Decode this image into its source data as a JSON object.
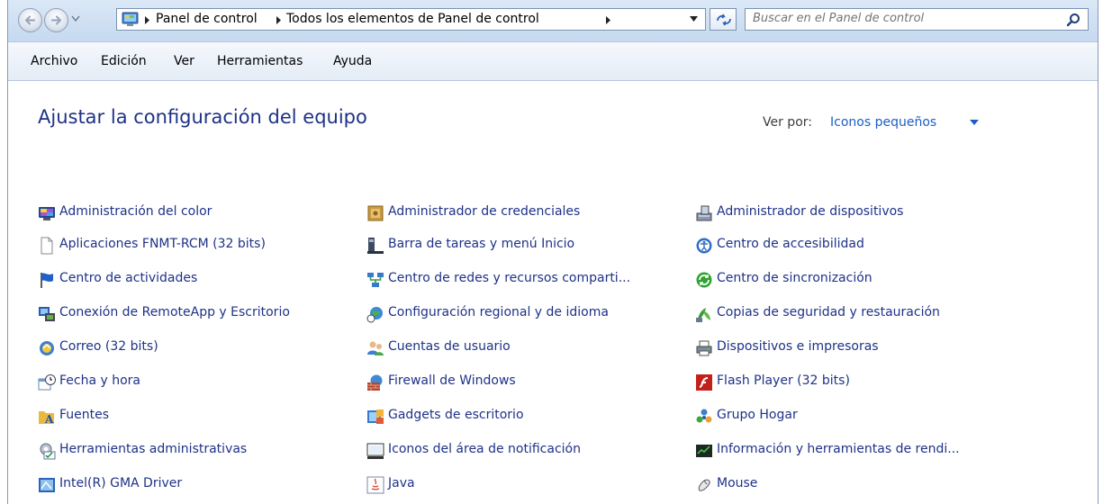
{
  "navigation": {
    "breadcrumbs": [
      "Panel de control",
      "Todos los elementos de Panel de control"
    ],
    "search_placeholder": "Buscar en el Panel de control"
  },
  "menu": [
    "Archivo",
    "Edición",
    "Ver",
    "Herramientas",
    "Ayuda"
  ],
  "page_title": "Ajustar la configuración del equipo",
  "view_by": {
    "label": "Ver por:",
    "value": "Iconos pequeños"
  },
  "columns": [
    [
      {
        "label": "Administración del color",
        "icon": "color-monitor-icon"
      },
      {
        "label": "Aplicaciones FNMT-RCM (32 bits)",
        "icon": "blank-document-icon"
      },
      {
        "label": "Centro de actividades",
        "icon": "flag-icon"
      },
      {
        "label": "Conexión de RemoteApp y Escritorio",
        "icon": "remoteapp-icon"
      },
      {
        "label": "Correo (32 bits)",
        "icon": "mail-icon"
      },
      {
        "label": "Fecha y hora",
        "icon": "calendar-clock-icon"
      },
      {
        "label": "Fuentes",
        "icon": "fonts-folder-icon"
      },
      {
        "label": "Herramientas administrativas",
        "icon": "admin-tools-icon"
      },
      {
        "label": "Intel(R) GMA Driver",
        "icon": "intel-icon"
      }
    ],
    [
      {
        "label": "Administrador de credenciales",
        "icon": "vault-icon"
      },
      {
        "label": "Barra de tareas y menú Inicio",
        "icon": "taskbar-icon"
      },
      {
        "label": "Centro de redes y recursos comparti...",
        "icon": "network-icon"
      },
      {
        "label": "Configuración regional y de idioma",
        "icon": "globe-clock-icon"
      },
      {
        "label": "Cuentas de usuario",
        "icon": "users-icon"
      },
      {
        "label": "Firewall de Windows",
        "icon": "firewall-icon"
      },
      {
        "label": "Gadgets de escritorio",
        "icon": "gadgets-icon"
      },
      {
        "label": "Iconos del área de notificación",
        "icon": "tray-icon"
      },
      {
        "label": "Java",
        "icon": "java-icon"
      }
    ],
    [
      {
        "label": "Administrador de dispositivos",
        "icon": "device-manager-icon"
      },
      {
        "label": "Centro de accesibilidad",
        "icon": "accessibility-icon"
      },
      {
        "label": "Centro de sincronización",
        "icon": "sync-icon"
      },
      {
        "label": "Copias de seguridad y restauración",
        "icon": "backup-icon"
      },
      {
        "label": "Dispositivos e impresoras",
        "icon": "printer-icon"
      },
      {
        "label": "Flash Player (32 bits)",
        "icon": "flash-icon"
      },
      {
        "label": "Grupo Hogar",
        "icon": "homegroup-icon"
      },
      {
        "label": "Información y herramientas de rendi...",
        "icon": "performance-icon"
      },
      {
        "label": "Mouse",
        "icon": "mouse-icon"
      }
    ]
  ]
}
